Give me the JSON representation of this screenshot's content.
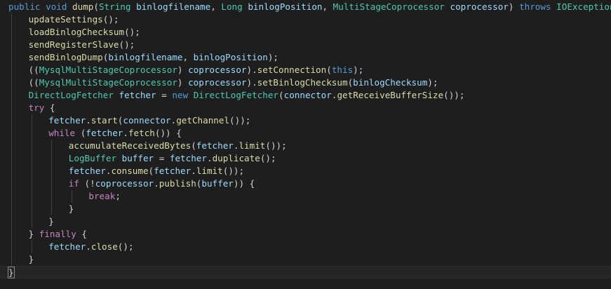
{
  "editor": {
    "theme": {
      "background": "#1e1e1e",
      "guide": "#404040",
      "current_line": "#252526"
    },
    "lines": [
      {
        "indent": 0,
        "tokens": [
          {
            "t": "public",
            "k": "keyword"
          },
          {
            "t": " ",
            "k": "plain"
          },
          {
            "t": "void",
            "k": "keyword"
          },
          {
            "t": " ",
            "k": "plain"
          },
          {
            "t": "dump",
            "k": "method"
          },
          {
            "t": "(",
            "k": "plain"
          },
          {
            "t": "String",
            "k": "type"
          },
          {
            "t": " ",
            "k": "plain"
          },
          {
            "t": "binlogfilename",
            "k": "variable"
          },
          {
            "t": ", ",
            "k": "plain"
          },
          {
            "t": "Long",
            "k": "type"
          },
          {
            "t": " ",
            "k": "plain"
          },
          {
            "t": "binlogPosition",
            "k": "variable"
          },
          {
            "t": ", ",
            "k": "plain"
          },
          {
            "t": "MultiStageCoprocessor",
            "k": "type"
          },
          {
            "t": " ",
            "k": "plain"
          },
          {
            "t": "coprocessor",
            "k": "variable"
          },
          {
            "t": ") ",
            "k": "plain"
          },
          {
            "t": "throws",
            "k": "keyword"
          },
          {
            "t": " ",
            "k": "plain"
          },
          {
            "t": "IOException",
            "k": "type"
          },
          {
            "t": " ",
            "k": "plain"
          },
          {
            "t": "{",
            "k": "bracket"
          }
        ]
      },
      {
        "indent": 1,
        "tokens": [
          {
            "t": "updateSettings",
            "k": "method"
          },
          {
            "t": "();",
            "k": "plain"
          }
        ]
      },
      {
        "indent": 1,
        "tokens": [
          {
            "t": "loadBinlogChecksum",
            "k": "method"
          },
          {
            "t": "();",
            "k": "plain"
          }
        ]
      },
      {
        "indent": 1,
        "tokens": [
          {
            "t": "sendRegisterSlave",
            "k": "method"
          },
          {
            "t": "();",
            "k": "plain"
          }
        ]
      },
      {
        "indent": 1,
        "tokens": [
          {
            "t": "sendBinlogDump",
            "k": "method"
          },
          {
            "t": "(",
            "k": "plain"
          },
          {
            "t": "binlogfilename",
            "k": "variable"
          },
          {
            "t": ", ",
            "k": "plain"
          },
          {
            "t": "binlogPosition",
            "k": "variable"
          },
          {
            "t": ");",
            "k": "plain"
          }
        ]
      },
      {
        "indent": 1,
        "tokens": [
          {
            "t": "((",
            "k": "plain"
          },
          {
            "t": "MysqlMultiStageCoprocessor",
            "k": "type"
          },
          {
            "t": ") ",
            "k": "plain"
          },
          {
            "t": "coprocessor",
            "k": "variable"
          },
          {
            "t": ").",
            "k": "plain"
          },
          {
            "t": "setConnection",
            "k": "method"
          },
          {
            "t": "(",
            "k": "plain"
          },
          {
            "t": "this",
            "k": "keyword"
          },
          {
            "t": ");",
            "k": "plain"
          }
        ]
      },
      {
        "indent": 1,
        "tokens": [
          {
            "t": "((",
            "k": "plain"
          },
          {
            "t": "MysqlMultiStageCoprocessor",
            "k": "type"
          },
          {
            "t": ") ",
            "k": "plain"
          },
          {
            "t": "coprocessor",
            "k": "variable"
          },
          {
            "t": ").",
            "k": "plain"
          },
          {
            "t": "setBinlogChecksum",
            "k": "method"
          },
          {
            "t": "(",
            "k": "plain"
          },
          {
            "t": "binlogChecksum",
            "k": "variable"
          },
          {
            "t": ");",
            "k": "plain"
          }
        ]
      },
      {
        "indent": 1,
        "tokens": [
          {
            "t": "DirectLogFetcher",
            "k": "type"
          },
          {
            "t": " ",
            "k": "plain"
          },
          {
            "t": "fetcher",
            "k": "variable"
          },
          {
            "t": " = ",
            "k": "plain"
          },
          {
            "t": "new",
            "k": "keyword"
          },
          {
            "t": " ",
            "k": "plain"
          },
          {
            "t": "DirectLogFetcher",
            "k": "type"
          },
          {
            "t": "(",
            "k": "plain"
          },
          {
            "t": "connector",
            "k": "variable"
          },
          {
            "t": ".",
            "k": "plain"
          },
          {
            "t": "getReceiveBufferSize",
            "k": "method"
          },
          {
            "t": "());",
            "k": "plain"
          }
        ]
      },
      {
        "indent": 1,
        "tokens": [
          {
            "t": "try",
            "k": "control"
          },
          {
            "t": " {",
            "k": "plain"
          }
        ]
      },
      {
        "indent": 2,
        "tokens": [
          {
            "t": "fetcher",
            "k": "variable"
          },
          {
            "t": ".",
            "k": "plain"
          },
          {
            "t": "start",
            "k": "method"
          },
          {
            "t": "(",
            "k": "plain"
          },
          {
            "t": "connector",
            "k": "variable"
          },
          {
            "t": ".",
            "k": "plain"
          },
          {
            "t": "getChannel",
            "k": "method"
          },
          {
            "t": "());",
            "k": "plain"
          }
        ]
      },
      {
        "indent": 2,
        "tokens": [
          {
            "t": "while",
            "k": "control"
          },
          {
            "t": " (",
            "k": "plain"
          },
          {
            "t": "fetcher",
            "k": "variable"
          },
          {
            "t": ".",
            "k": "plain"
          },
          {
            "t": "fetch",
            "k": "method"
          },
          {
            "t": "()) {",
            "k": "plain"
          }
        ]
      },
      {
        "indent": 3,
        "tokens": [
          {
            "t": "accumulateReceivedBytes",
            "k": "method"
          },
          {
            "t": "(",
            "k": "plain"
          },
          {
            "t": "fetcher",
            "k": "variable"
          },
          {
            "t": ".",
            "k": "plain"
          },
          {
            "t": "limit",
            "k": "method"
          },
          {
            "t": "());",
            "k": "plain"
          }
        ]
      },
      {
        "indent": 3,
        "tokens": [
          {
            "t": "LogBuffer",
            "k": "type"
          },
          {
            "t": " ",
            "k": "plain"
          },
          {
            "t": "buffer",
            "k": "variable"
          },
          {
            "t": " = ",
            "k": "plain"
          },
          {
            "t": "fetcher",
            "k": "variable"
          },
          {
            "t": ".",
            "k": "plain"
          },
          {
            "t": "duplicate",
            "k": "method"
          },
          {
            "t": "();",
            "k": "plain"
          }
        ]
      },
      {
        "indent": 3,
        "tokens": [
          {
            "t": "fetcher",
            "k": "variable"
          },
          {
            "t": ".",
            "k": "plain"
          },
          {
            "t": "consume",
            "k": "method"
          },
          {
            "t": "(",
            "k": "plain"
          },
          {
            "t": "fetcher",
            "k": "variable"
          },
          {
            "t": ".",
            "k": "plain"
          },
          {
            "t": "limit",
            "k": "method"
          },
          {
            "t": "());",
            "k": "plain"
          }
        ]
      },
      {
        "indent": 3,
        "tokens": [
          {
            "t": "if",
            "k": "control"
          },
          {
            "t": " (!",
            "k": "plain"
          },
          {
            "t": "coprocessor",
            "k": "variable"
          },
          {
            "t": ".",
            "k": "plain"
          },
          {
            "t": "publish",
            "k": "method"
          },
          {
            "t": "(",
            "k": "plain"
          },
          {
            "t": "buffer",
            "k": "variable"
          },
          {
            "t": ")) {",
            "k": "plain"
          }
        ]
      },
      {
        "indent": 4,
        "tokens": [
          {
            "t": "break",
            "k": "control"
          },
          {
            "t": ";",
            "k": "plain"
          }
        ]
      },
      {
        "indent": 3,
        "tokens": [
          {
            "t": "}",
            "k": "plain"
          }
        ]
      },
      {
        "indent": 2,
        "tokens": [
          {
            "t": "}",
            "k": "plain"
          }
        ]
      },
      {
        "indent": 1,
        "tokens": [
          {
            "t": "} ",
            "k": "plain"
          },
          {
            "t": "finally",
            "k": "control"
          },
          {
            "t": " {",
            "k": "plain"
          }
        ]
      },
      {
        "indent": 2,
        "tokens": [
          {
            "t": "fetcher",
            "k": "variable"
          },
          {
            "t": ".",
            "k": "plain"
          },
          {
            "t": "close",
            "k": "method"
          },
          {
            "t": "();",
            "k": "plain"
          }
        ]
      },
      {
        "indent": 1,
        "tokens": [
          {
            "t": "}",
            "k": "plain"
          }
        ]
      },
      {
        "indent": 0,
        "current": true,
        "tokens": [
          {
            "t": "}",
            "k": "bracket"
          }
        ]
      }
    ]
  }
}
